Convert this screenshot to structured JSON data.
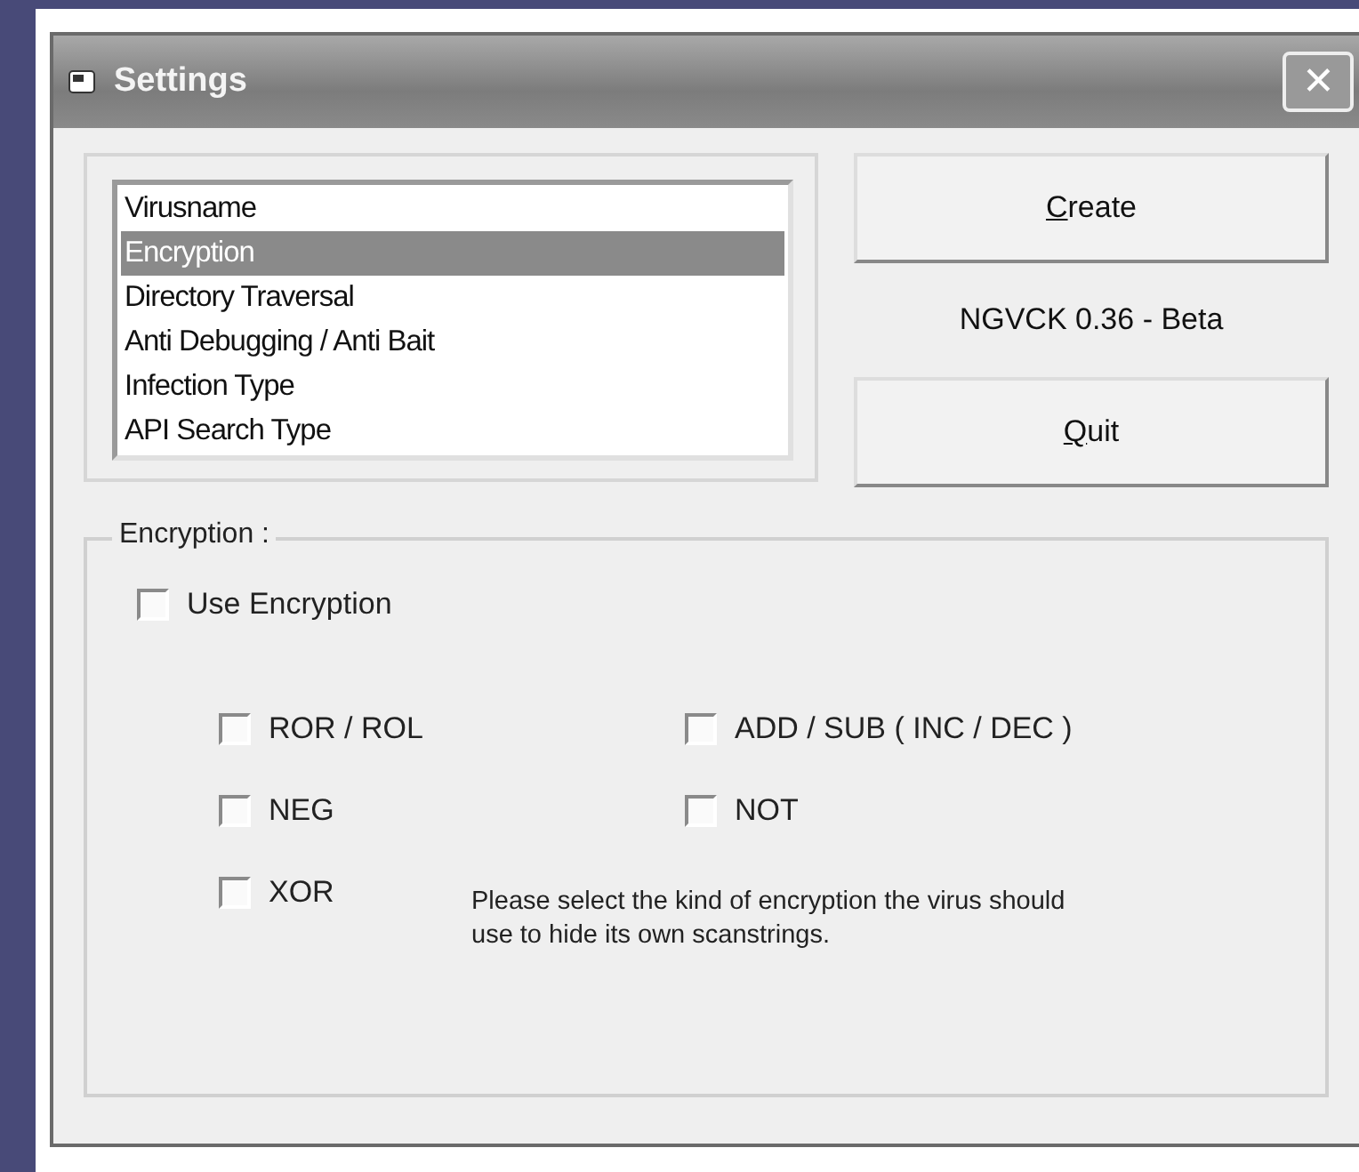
{
  "window": {
    "title": "Settings",
    "close": "✕"
  },
  "list": {
    "items": [
      {
        "label": "Virusname",
        "selected": false
      },
      {
        "label": "Encryption",
        "selected": true
      },
      {
        "label": "Directory Traversal",
        "selected": false
      },
      {
        "label": "Anti Debugging / Anti Bait",
        "selected": false
      },
      {
        "label": "Infection Type",
        "selected": false
      },
      {
        "label": "API Search Type",
        "selected": false
      }
    ]
  },
  "buttons": [
    {
      "label": "Create"
    },
    {
      "label": "Quit"
    }
  ],
  "version": "NGVCK 0.36 - Beta",
  "group": {
    "title": "Encryption :",
    "use": {
      "label": "Use Encryption",
      "checked": false
    },
    "options": [
      {
        "label": "ROR / ROL",
        "checked": false
      },
      {
        "label": "ADD / SUB ( INC / DEC )",
        "checked": false
      },
      {
        "label": "NEG",
        "checked": false
      },
      {
        "label": "NOT",
        "checked": false
      },
      {
        "label": "XOR",
        "checked": false
      }
    ],
    "help": "Please select the kind of encryption the virus should use to hide its own scanstrings."
  }
}
